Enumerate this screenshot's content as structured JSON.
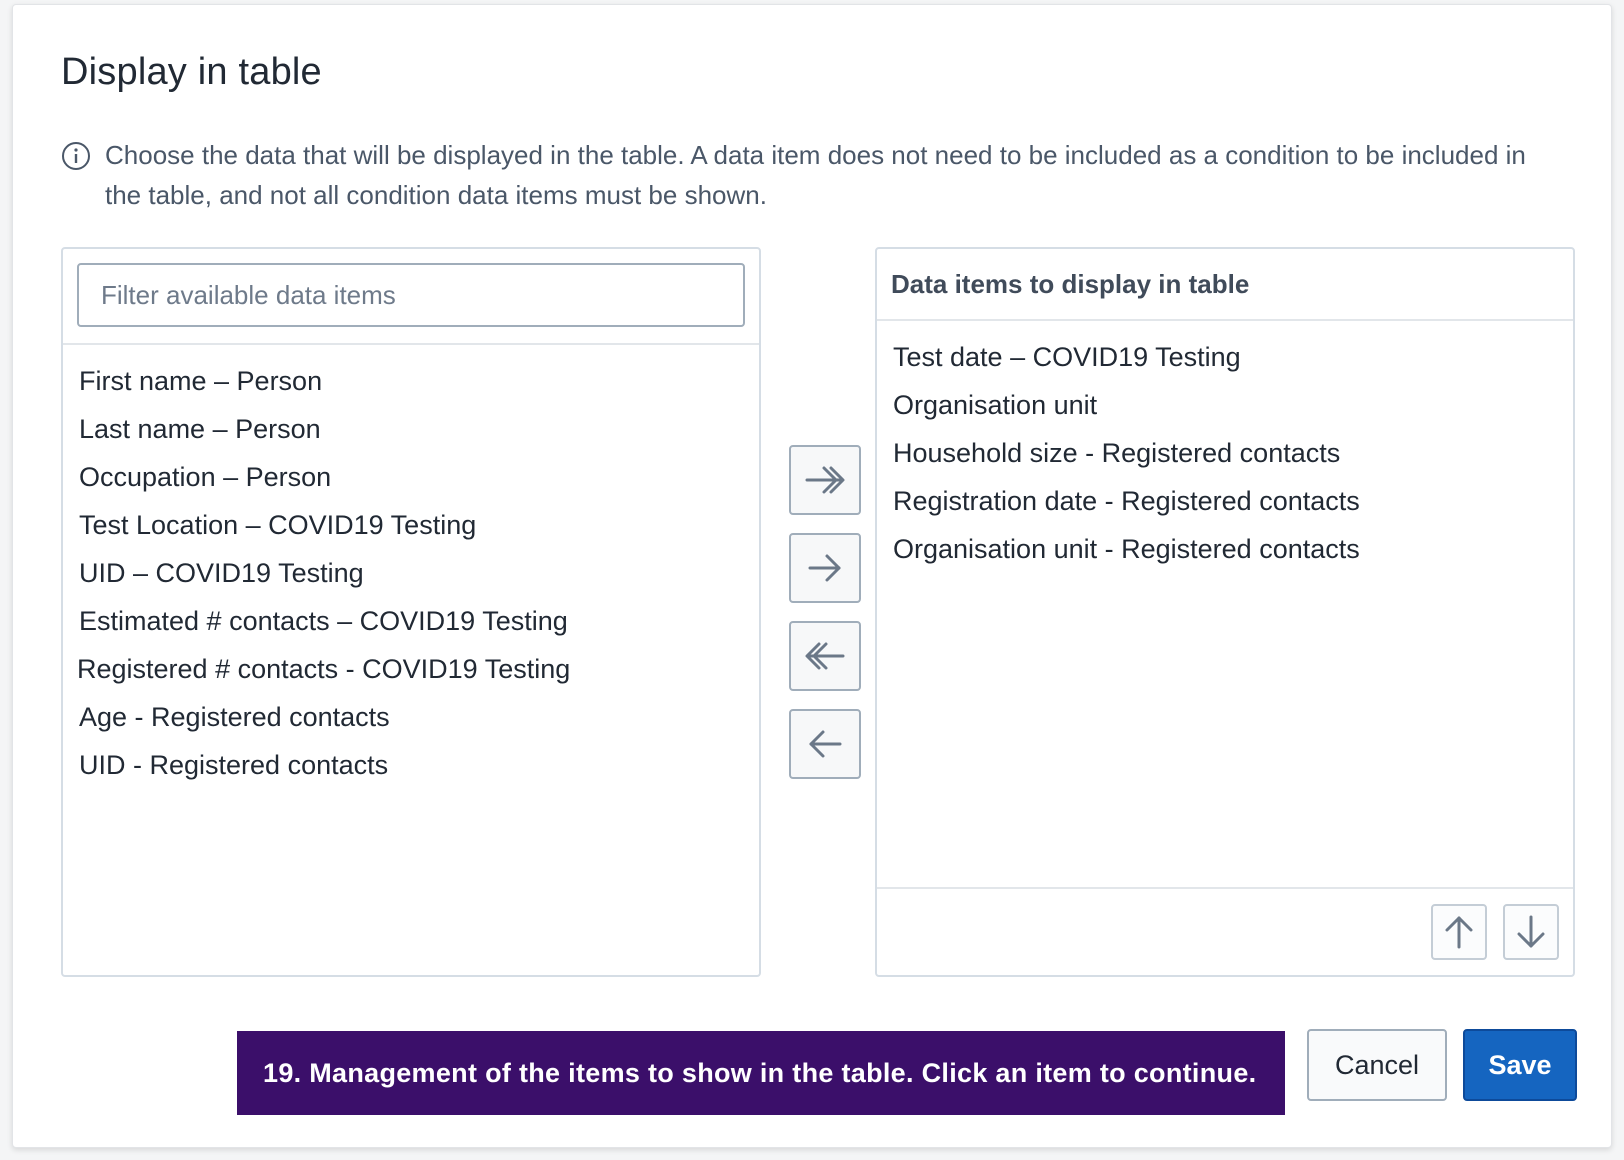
{
  "dialog": {
    "title": "Display in table",
    "help_text": "Choose the data that will be displayed in the table. A data item does not need to be included as a condition to be included in the table, and not all condition data items must be shown."
  },
  "available": {
    "filter_placeholder": "Filter available data items",
    "items": [
      "First name – Person",
      "Last name – Person",
      "Occupation – Person",
      "Test Location – COVID19 Testing",
      "UID – COVID19 Testing",
      "Estimated # contacts – COVID19 Testing",
      "Registered # contacts - COVID19 Testing",
      "Age - Registered contacts",
      "UID - Registered contacts"
    ]
  },
  "selected": {
    "header": "Data items to display in table",
    "items": [
      "Test date – COVID19 Testing",
      "Organisation unit",
      "Household size - Registered contacts",
      "Registration date - Registered contacts",
      "Organisation unit - Registered contacts"
    ]
  },
  "transfer_buttons": [
    "double-arrow-right-icon",
    "arrow-right-icon",
    "double-arrow-left-icon",
    "arrow-left-icon"
  ],
  "order_buttons": [
    "arrow-up-icon",
    "arrow-down-icon"
  ],
  "tooltip": "19. Management of the items to show in the table. Click an item to continue.",
  "actions": {
    "cancel": "Cancel",
    "save": "Save"
  },
  "colors": {
    "primary": "#1565c0",
    "tooltip_bg": "#3b0f6a",
    "icon": "#6b7888"
  }
}
